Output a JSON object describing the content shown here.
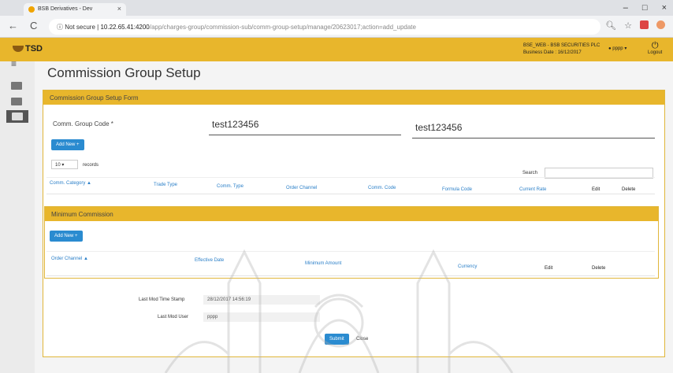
{
  "browser": {
    "tab_title": "BSB Derivatives - Dev",
    "tab_close": "×",
    "security_label": "Not secure",
    "url_host": "10.22.65.41:4200",
    "url_path": "/app/charges-group/commission-sub/comm-group-setup/manage/20623017;action=add_update",
    "window_controls": [
      "–",
      "□",
      "×"
    ],
    "back": "←",
    "reload": "C"
  },
  "appbar": {
    "logo": "TSD",
    "company": "BSE_WEB - BSB SECURITIES PLC",
    "business_date": "Business Date : 16/12/2017",
    "user": "pppp",
    "logout": "Logout"
  },
  "page": {
    "title": "Commission Group Setup",
    "form_title": "Commission Group Setup Form",
    "comm_group_code_label": "Comm. Group Code *",
    "comm_group_code_value": "test123456",
    "comm_group_code_value_2": "test123456",
    "add_new_label": "Add New +",
    "records_select": "10",
    "records_label": "records",
    "search_label": "Search",
    "commission_columns": [
      "Comm. Category ▲",
      "Trade Type",
      "Comm. Type",
      "Order Channel",
      "Comm. Code",
      "Formula Code",
      "Current Rate",
      "Edit",
      "Delete"
    ],
    "min_commission_title": "Minimum Commission",
    "min_add_new_label": "Add New +",
    "min_columns": [
      "Order Channel ▲",
      "Effective Date",
      "Minimum Amount",
      "Currency",
      "Edit",
      "Delete"
    ],
    "last_mod_ts_label": "Last Mod Time Stamp",
    "last_mod_ts_value": "28/12/2017 14:56:19",
    "last_mod_user_label": "Last Mod User",
    "last_mod_user_value": "pppp",
    "submit_label": "Submit",
    "close_label": "Close"
  }
}
